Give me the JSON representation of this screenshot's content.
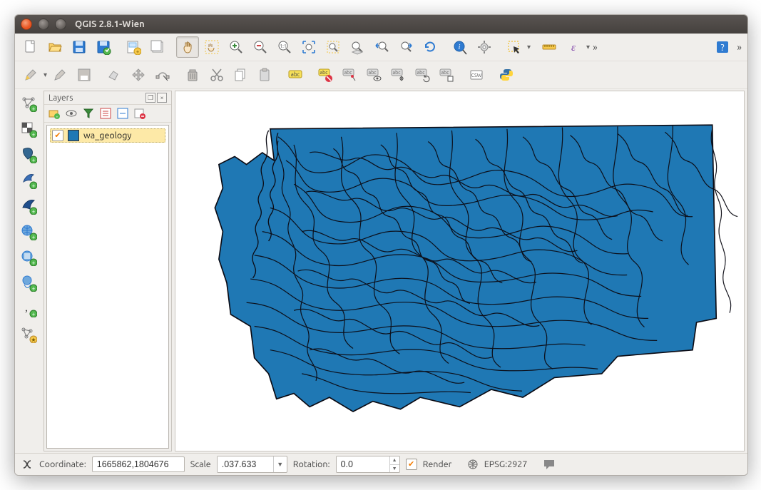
{
  "window": {
    "title": "QGIS 2.8.1-Wien"
  },
  "toolbar1": {
    "icons": {
      "new_project": "new-project-icon",
      "open_project": "open-project-icon",
      "save_project": "save-project-icon",
      "save_as": "save-project-as-icon",
      "new_print": "new-print-composer-icon",
      "composer_manager": "composer-manager-icon",
      "pan": "pan-icon",
      "pan_selection": "pan-to-selection-icon",
      "zoom_in": "zoom-in-icon",
      "zoom_out": "zoom-out-icon",
      "zoom_native": "zoom-native-icon",
      "zoom_full": "zoom-full-icon",
      "zoom_selection": "zoom-to-selection-icon",
      "zoom_layer": "zoom-to-layer-icon",
      "zoom_last": "zoom-last-icon",
      "zoom_next": "zoom-next-icon",
      "refresh": "refresh-icon",
      "identify": "identify-icon",
      "settings": "options-icon",
      "select": "select-features-icon",
      "measure": "measure-icon",
      "expression": "expression-icon",
      "help": "help-icon"
    }
  },
  "toolbar2": {
    "icons": {
      "toggle_editing": "toggle-editing-icon",
      "edit_pencil": "current-edits-icon",
      "save_edits": "save-layer-edits-icon",
      "add_feature": "add-feature-icon",
      "move_feature": "move-feature-icon",
      "node_tool": "node-tool-icon",
      "delete": "delete-selected-icon",
      "cut": "cut-features-icon",
      "copy": "copy-features-icon",
      "paste": "paste-features-icon",
      "label_abc": "labeling-icon",
      "label_settings": "label-settings-icon",
      "label_pin": "pin-label-icon",
      "label_show": "show-hide-labels-icon",
      "label_move": "move-label-icon",
      "label_rotate": "rotate-label-icon",
      "label_change": "change-label-icon",
      "csw": "metasearch-icon",
      "python": "python-console-icon"
    }
  },
  "left_toolbox": {
    "icons": {
      "add_vector": "add-vector-layer-icon",
      "add_raster": "add-raster-layer-icon",
      "add_postgis": "add-postgis-layer-icon",
      "add_spatialite": "add-spatialite-layer-icon",
      "add_mssql": "add-mssql-layer-icon",
      "add_wms": "add-wms-layer-icon",
      "add_wcs": "add-wcs-layer-icon",
      "add_wfs": "add-wfs-layer-icon",
      "add_delimited": "add-delimited-text-icon",
      "new_shapefile": "new-shapefile-icon"
    }
  },
  "layers_panel": {
    "title": "Layers",
    "toolbar": {
      "add_group": "add-group-icon",
      "manage_visibility": "manage-visibility-icon",
      "filter": "filter-legend-icon",
      "expand_all": "expand-all-icon",
      "collapse_all": "collapse-all-icon",
      "remove": "remove-layer-icon"
    },
    "items": [
      {
        "checked": true,
        "swatch": "#1f78b4",
        "name": "wa_geology"
      }
    ]
  },
  "statusbar": {
    "coordinate_label": "Coordinate:",
    "coordinate_value": "1665862,1804676",
    "scale_label": "Scale",
    "scale_value": ".037.633",
    "rotation_label": "Rotation:",
    "rotation_value": "0.0",
    "render_checked": true,
    "render_label": "Render",
    "crs_label": "EPSG:2927"
  }
}
